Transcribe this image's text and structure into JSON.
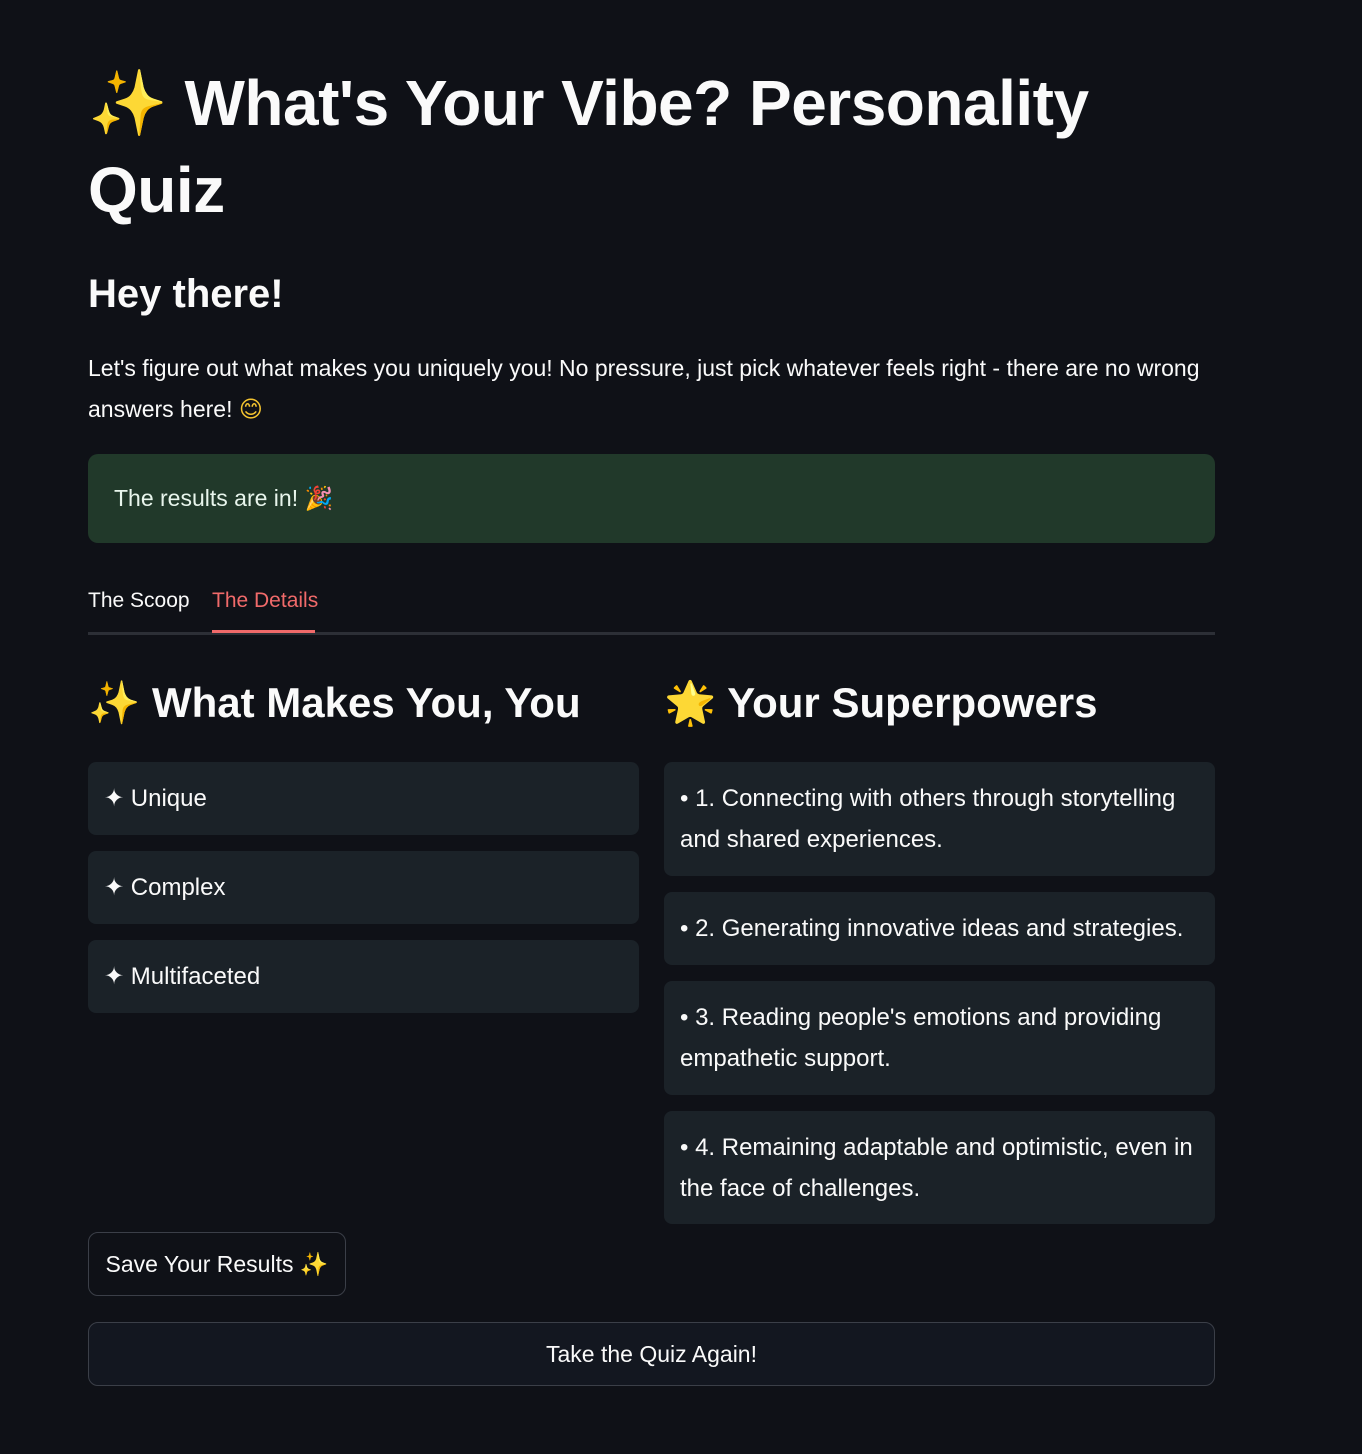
{
  "header": {
    "title_icon": "sparkles-icon",
    "title_icon_glyph": "✨",
    "title": "What's Your Vibe? Personality Quiz",
    "subtitle": "Hey there!",
    "intro": "Let's figure out what makes you uniquely you! No pressure, just pick whatever feels right - there are no wrong answers here!",
    "intro_emoji": "😊"
  },
  "alert": {
    "text": "The results are in!",
    "emoji": "🎉",
    "background": "#21392a"
  },
  "tabs": [
    {
      "label": "The Scoop",
      "active": false
    },
    {
      "label": "The Details",
      "active": true
    }
  ],
  "left_column": {
    "icon": "sparkles-icon",
    "icon_glyph": "✨",
    "title": "What Makes You, You",
    "traits": [
      {
        "bullet": "✦",
        "label": "Unique"
      },
      {
        "bullet": "✦",
        "label": "Complex"
      },
      {
        "bullet": "✦",
        "label": "Multifaceted"
      }
    ]
  },
  "right_column": {
    "icon": "glowing-star-icon",
    "icon_glyph": "🌟",
    "title": "Your Superpowers",
    "superpowers": [
      "• 1. Connecting with others through storytelling and shared experiences.",
      "• 2. Generating innovative ideas and strategies.",
      "• 3. Reading people's emotions and providing empathetic support.",
      "• 4. Remaining adaptable and optimistic, even in the face of challenges."
    ]
  },
  "buttons": {
    "save_label": "Save Your Results",
    "save_icon": "✨",
    "again_label": "Take the Quiz Again!"
  },
  "colors": {
    "background": "#0f1117",
    "accent": "#f06a6a",
    "card": "#1b2228"
  }
}
